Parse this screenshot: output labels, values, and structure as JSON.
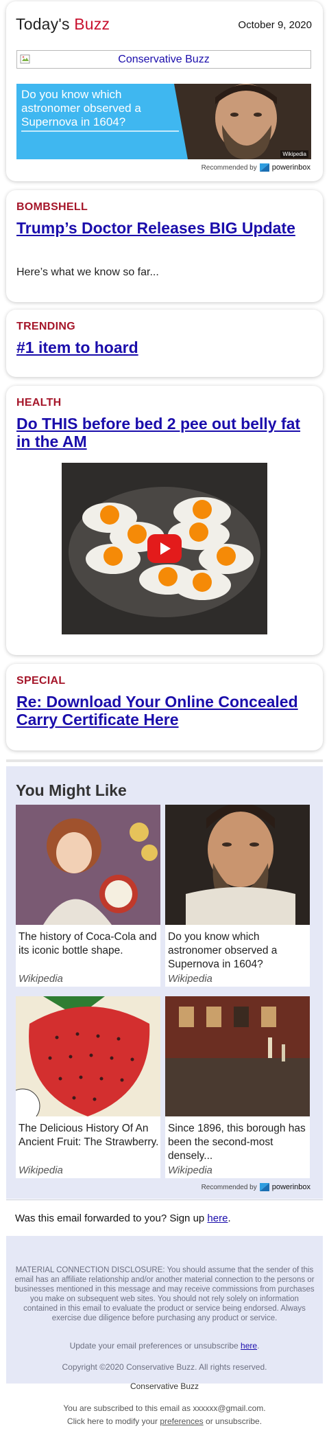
{
  "header": {
    "brand_prefix": "Today's ",
    "brand_accent": "Buzz",
    "date": "October 9, 2020",
    "logo_alt": "Conservative Buzz",
    "ad": {
      "text": "Do you know which astronomer observed a Supernova in 1604?",
      "image_source": "Wikipedia"
    },
    "recommended_by": "Recommended by",
    "powerinbox": "powerinbox"
  },
  "colors": {
    "accent": "#c8102e",
    "kicker": "#a5162a",
    "link": "#1a0dab",
    "ad_blue": "#3fb7f0",
    "panel_bg": "#e5e8f6"
  },
  "stories": [
    {
      "kicker": "BOMBSHELL",
      "headline": "Trump’s Doctor Releases BIG Update ",
      "dek": "Here’s what we know so far..."
    },
    {
      "kicker": "TRENDING",
      "headline": "#1 item to hoard"
    },
    {
      "kicker": "HEALTH",
      "headline": "Do THIS before bed 2 pee out belly fat in the AM",
      "video_icon": "play-button-icon"
    },
    {
      "kicker": "SPECIAL",
      "headline": "Re: Download Your Online Concealed Carry Certificate Here"
    }
  ],
  "you_might_like": {
    "title": "You Might Like",
    "items": [
      {
        "text": "The history of Coca-Cola and its iconic bottle shape.",
        "source": "Wikipedia"
      },
      {
        "text": "Do you know which astronomer observed a Supernova in 1604?",
        "source": "Wikipedia"
      },
      {
        "text": "The Delicious History Of An Ancient Fruit: The Strawberry.",
        "source": "Wikipedia"
      },
      {
        "text": "Since 1896, this borough has been the second-most densely...",
        "source": "Wikipedia"
      }
    ],
    "recommended_by": "Recommended by",
    "powerinbox": "powerinbox"
  },
  "footer": {
    "forwarded_text": "Was this email forwarded to you? Sign up ",
    "forwarded_link": "here",
    "forwarded_end": ".",
    "disclosure": "MATERIAL CONNECTION DISCLOSURE: You should assume that the sender of this email has an affiliate relationship and/or another material connection to the persons or businesses mentioned in this message and may receive commissions from purchases you make on subsequent web sites. You should not rely solely on information contained in this email to evaluate the product or service being endorsed. Always exercise due diligence before purchasing any product or service.",
    "prefs_text": "Update your email preferences or unsubscribe ",
    "prefs_link": "here",
    "prefs_end": ".",
    "copyright": "Copyright ©2020 Conservative Buzz. All rights reserved.",
    "company": "Conservative Buzz",
    "subscribed": "You are subscribed to this email as xxxxxx@gmail.com.",
    "modify_prefix": "Click here to modify your ",
    "modify_link": "preferences",
    "modify_suffix": " or unsubscribe."
  }
}
